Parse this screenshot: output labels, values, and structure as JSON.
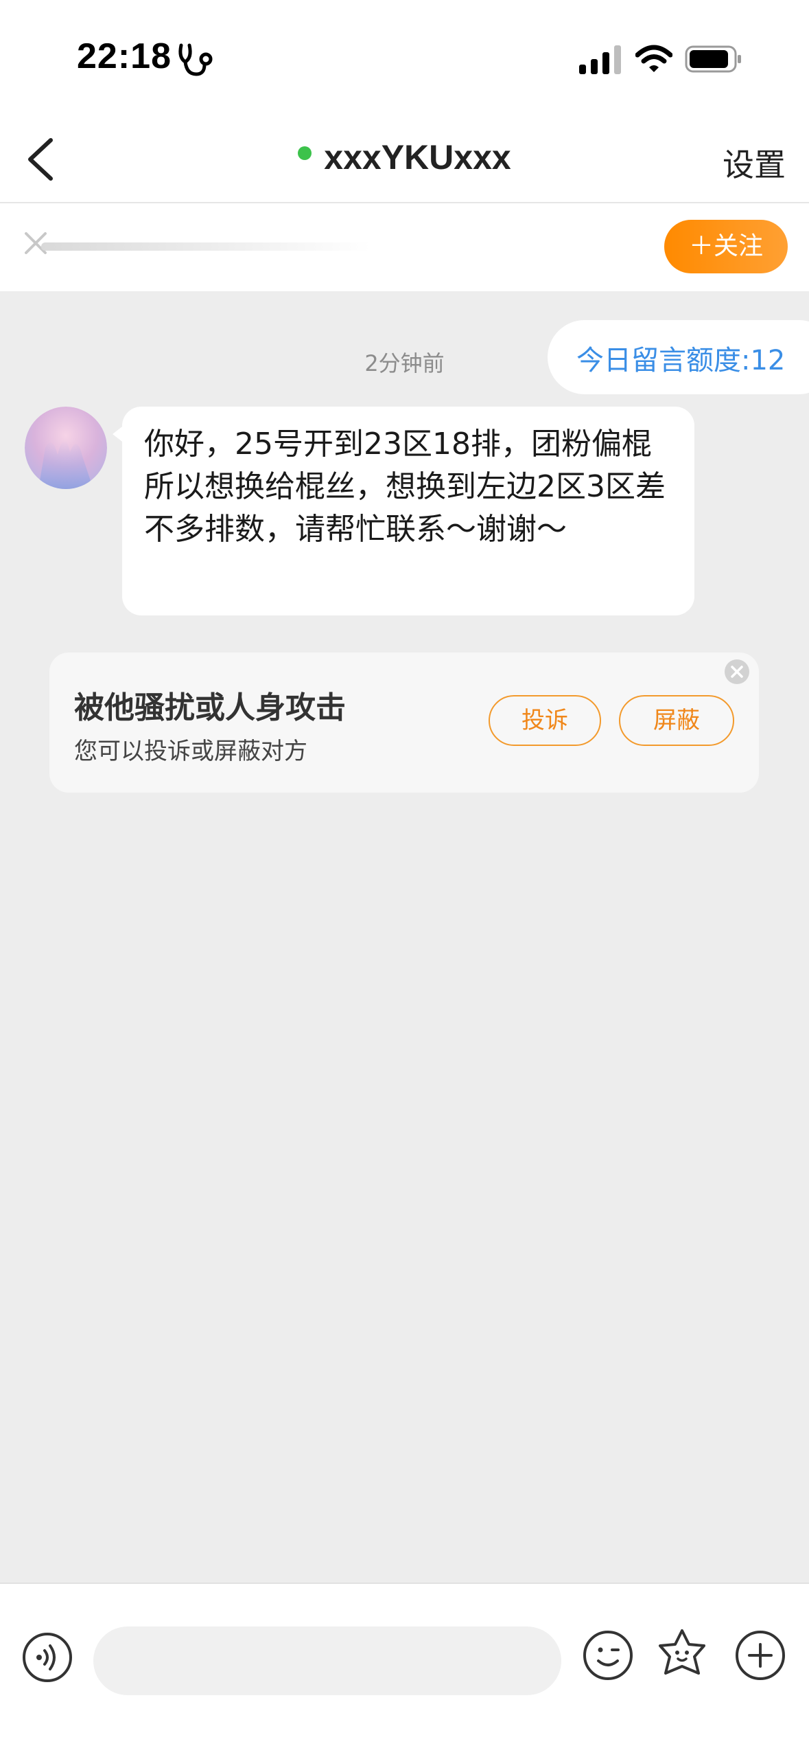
{
  "status_bar": {
    "time": "22:18"
  },
  "nav": {
    "title": "xxxYKUxxx",
    "settings_label": "设置",
    "online_status_color": "#3cc24b"
  },
  "follow_bar": {
    "follow_label": "＋关注"
  },
  "chat": {
    "quota_label": "今日留言额度:12",
    "timestamp": "2分钟前",
    "messages": [
      {
        "sender": "other",
        "text": "你好，25号开到23区18排，团粉偏棍所以想换给棍丝，想换到左边2区3区差不多排数，请帮忙联系～谢谢～"
      }
    ]
  },
  "harassment_card": {
    "title": "被他骚扰或人身攻击",
    "subtitle": "您可以投诉或屏蔽对方",
    "report_label": "投诉",
    "block_label": "屏蔽"
  },
  "input_bar": {
    "input_value": "",
    "icons": [
      "voice-icon",
      "emoji-icon",
      "sticker-icon",
      "plus-icon"
    ]
  },
  "colors": {
    "accent_orange": "#ff8a00",
    "quota_blue": "#3a8ee6",
    "background": "#ededed"
  }
}
